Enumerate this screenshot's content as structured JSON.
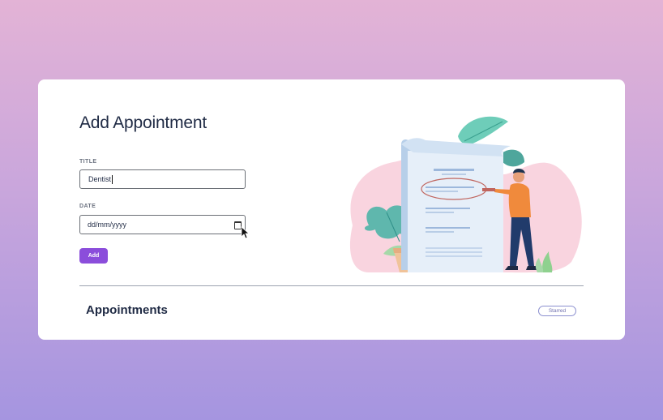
{
  "form": {
    "title": "Add Appointment",
    "title_label": "TITLE",
    "title_value": "Dentist",
    "date_label": "DATE",
    "date_placeholder": "dd/mm/yyyy",
    "add_label": "Add"
  },
  "list": {
    "title": "Appointments",
    "starred_label": "Starred"
  },
  "icons": {
    "calendar": "calendar-icon",
    "cursor": "mouse-pointer-icon",
    "illustration": "appointment-illustration"
  },
  "colors": {
    "accent": "#8b4ddb",
    "heading": "#1f2a44",
    "starred_border": "#8b8fcf"
  }
}
